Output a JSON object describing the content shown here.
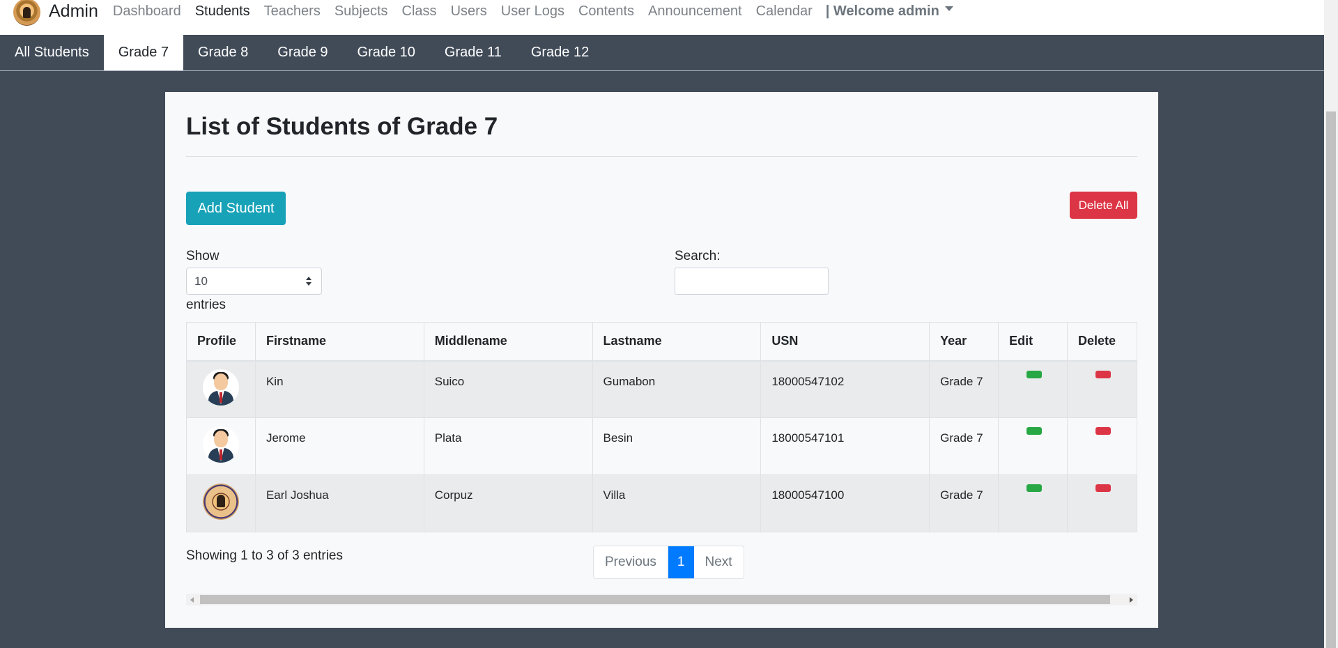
{
  "navbar": {
    "brand": "Admin",
    "items": [
      "Dashboard",
      "Students",
      "Teachers",
      "Subjects",
      "Class",
      "Users",
      "User Logs",
      "Contents",
      "Announcement",
      "Calendar"
    ],
    "active": "Students",
    "welcome": "| Welcome admin"
  },
  "tabs": {
    "items": [
      "All Students",
      "Grade 7",
      "Grade 8",
      "Grade 9",
      "Grade 10",
      "Grade 11",
      "Grade 12"
    ],
    "active": "Grade 7"
  },
  "main": {
    "title": "List of Students of Grade 7",
    "add_button": "Add Student",
    "delete_all_button": "Delete All",
    "show_label": "Show",
    "show_value": "10",
    "entries_label": "entries",
    "search_label": "Search:",
    "search_value": ""
  },
  "table": {
    "columns": [
      "Profile",
      "Firstname",
      "Middlename",
      "Lastname",
      "USN",
      "Year",
      "Edit",
      "Delete"
    ],
    "rows": [
      {
        "avatar": "male-avatar-icon",
        "firstname": "Kin",
        "middlename": "Suico",
        "lastname": "Gumabon",
        "usn": "18000547102",
        "year": "Grade 7"
      },
      {
        "avatar": "male-avatar-icon",
        "firstname": "Jerome",
        "middlename": "Plata",
        "lastname": "Besin",
        "usn": "18000547101",
        "year": "Grade 7"
      },
      {
        "avatar": "school-seal-icon",
        "firstname": "Earl Joshua",
        "middlename": "Corpuz",
        "lastname": "Villa",
        "usn": "18000547100",
        "year": "Grade 7"
      }
    ]
  },
  "footer": {
    "info": "Showing 1 to 3 of 3 entries",
    "prev": "Previous",
    "page": "1",
    "next": "Next"
  },
  "colors": {
    "navbar_bg": "#ffffff",
    "page_bg": "#414b58",
    "add_button": "#17a2b8",
    "delete_button": "#dc3545",
    "edit_pill": "#28a745",
    "active_page": "#007bff"
  }
}
